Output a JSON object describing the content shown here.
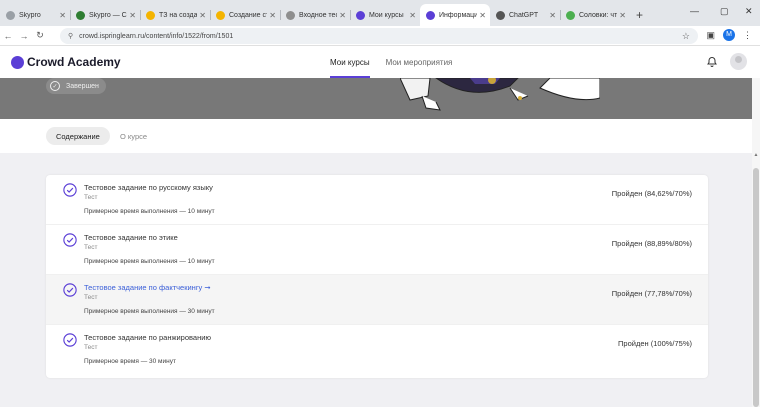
{
  "browser": {
    "tabs": [
      {
        "title": "Skypro",
        "color": "#9aa0a6",
        "active": false
      },
      {
        "title": "Skypro — Cr",
        "color": "#2e7d32",
        "active": false
      },
      {
        "title": "ТЗ на создан",
        "color": "#f4b400",
        "active": false
      },
      {
        "title": "Создание ст",
        "color": "#f4b400",
        "active": false
      },
      {
        "title": "Входное тес",
        "color": "#8e8e8e",
        "active": false
      },
      {
        "title": "Мои курсы",
        "color": "#5b3fd6",
        "active": false
      },
      {
        "title": "Информаци",
        "color": "#5b3fd6",
        "active": true
      },
      {
        "title": "ChatGPT",
        "color": "#555555",
        "active": false
      },
      {
        "title": "Соловки: что",
        "color": "#4caf50",
        "active": false
      }
    ],
    "new_tab": "+",
    "url": "crowd.ispringlearn.ru/content/info/1522/from/1501",
    "profile_initial": "M"
  },
  "header": {
    "logo": "Crowd Academy",
    "nav": [
      {
        "label": "Мои курсы",
        "active": true
      },
      {
        "label": "Мои мероприятия",
        "active": false
      }
    ]
  },
  "banner": {
    "status": "Завершен"
  },
  "content_tabs": {
    "active": "Содержание",
    "inactive": "О курсе"
  },
  "items": [
    {
      "title": "Тестовое задание по русскому языку",
      "kind": "Тест",
      "time": "Примерное время выполнения — 10 минут",
      "result": "Пройден (84,62%/70%)",
      "highlighted": false,
      "link": false
    },
    {
      "title": "Тестовое задание по этике",
      "kind": "Тест",
      "time": "Примерное время выполнения — 10 минут",
      "result": "Пройден (88,89%/80%)",
      "highlighted": false,
      "link": false
    },
    {
      "title": "Тестовое задание по фактчекингу",
      "kind": "Тест",
      "time": "Примерное время выполнения — 30 минут",
      "result": "Пройден (77,78%/70%)",
      "highlighted": true,
      "link": true
    },
    {
      "title": "Тестовое задание по ранжированию",
      "kind": "Тест",
      "time": "Примерное время — 30 минут",
      "result": "Пройден (100%/75%)",
      "highlighted": false,
      "link": false
    }
  ],
  "colors": {
    "accent": "#5b3fd6",
    "link": "#3b5fd8",
    "banner": "#787878"
  }
}
